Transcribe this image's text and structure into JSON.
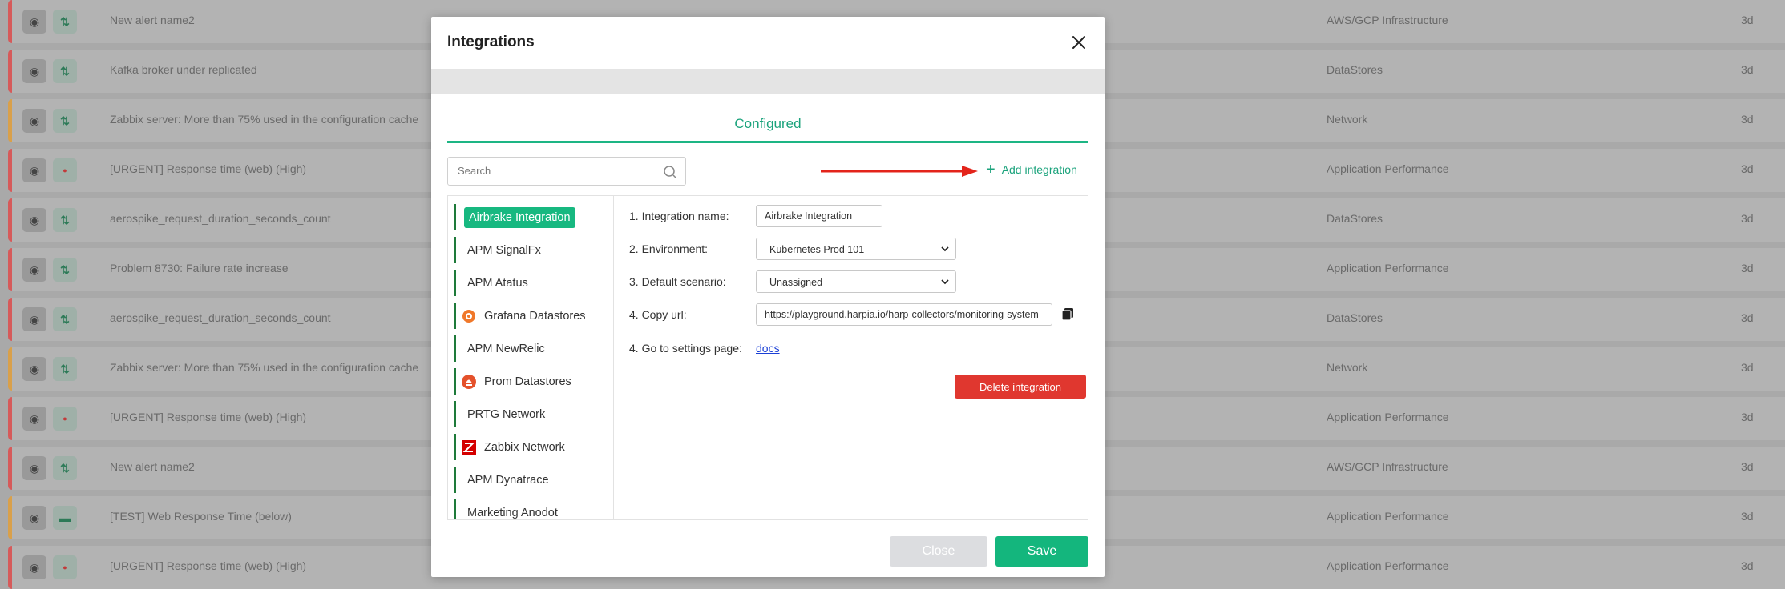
{
  "colors": {
    "accent": "#1db584",
    "danger": "#e0372f",
    "stripe_red": "#d65a5a",
    "stripe_orange": "#d9a04a"
  },
  "background_rows": [
    {
      "title": "New alert name2",
      "category": "AWS/GCP Infrastructure",
      "age": "3d",
      "stripe": "red",
      "status_icon": "arrows-icon"
    },
    {
      "title": "Kafka broker under replicated",
      "category": "DataStores",
      "age": "3d",
      "stripe": "red",
      "status_icon": "arrows-icon"
    },
    {
      "title": "Zabbix server: More than 75% used in the configuration cache",
      "category": "Network",
      "age": "3d",
      "stripe": "orange",
      "status_icon": "arrows-icon"
    },
    {
      "title": "[URGENT] Response time (web) (High)",
      "category": "Application Performance",
      "age": "3d",
      "stripe": "red",
      "status_icon": "dot-icon"
    },
    {
      "title": "aerospike_request_duration_seconds_count",
      "category": "DataStores",
      "age": "3d",
      "stripe": "red",
      "status_icon": "arrows-icon"
    },
    {
      "title": "Problem 8730: Failure rate increase",
      "category": "Application Performance",
      "age": "3d",
      "stripe": "red",
      "status_icon": "arrows-icon"
    },
    {
      "title": "aerospike_request_duration_seconds_count",
      "category": "DataStores",
      "age": "3d",
      "stripe": "red",
      "status_icon": "arrows-icon"
    },
    {
      "title": "Zabbix server: More than 75% used in the configuration cache",
      "category": "Network",
      "age": "3d",
      "stripe": "orange",
      "status_icon": "arrows-icon"
    },
    {
      "title": "[URGENT] Response time (web) (High)",
      "category": "Application Performance",
      "age": "3d",
      "stripe": "red",
      "status_icon": "dot-icon"
    },
    {
      "title": "New alert name2",
      "category": "AWS/GCP Infrastructure",
      "age": "3d",
      "stripe": "red",
      "status_icon": "arrows-icon"
    },
    {
      "title": "[TEST] Web Response Time (below)",
      "category": "Application Performance",
      "age": "3d",
      "stripe": "orange",
      "status_icon": "badge-icon"
    },
    {
      "title": "[URGENT] Response time (web) (High)",
      "category": "Application Performance",
      "age": "3d",
      "stripe": "red",
      "status_icon": "dot-icon"
    }
  ],
  "modal": {
    "title": "Integrations",
    "tab_label": "Configured",
    "search_placeholder": "Search",
    "add_integration_label": "Add integration",
    "integrations": [
      {
        "label": "Airbrake Integration",
        "icon": "",
        "active": true
      },
      {
        "label": "APM SignalFx",
        "icon": ""
      },
      {
        "label": "APM Atatus",
        "icon": ""
      },
      {
        "label": "Grafana Datastores",
        "icon": "grafana-icon"
      },
      {
        "label": "APM NewRelic",
        "icon": ""
      },
      {
        "label": "Prom Datastores",
        "icon": "prometheus-icon"
      },
      {
        "label": "PRTG Network",
        "icon": ""
      },
      {
        "label": "Zabbix Network",
        "icon": "zabbix-icon"
      },
      {
        "label": "APM Dynatrace",
        "icon": ""
      },
      {
        "label": "Marketing Anodot",
        "icon": ""
      }
    ],
    "form": {
      "name_label": "1. Integration name:",
      "name_value": "Airbrake Integration",
      "env_label": "2. Environment:",
      "env_value": "Kubernetes Prod 101",
      "scenario_label": "3. Default scenario:",
      "scenario_value": "Unassigned",
      "url_label": "4. Copy url:",
      "url_value": "https://playground.harpia.io/harp-collectors/monitoring-system",
      "settings_label": "4. Go to settings page:",
      "docs_link": "docs",
      "delete_label": "Delete integration"
    },
    "close_label": "Close",
    "save_label": "Save"
  }
}
